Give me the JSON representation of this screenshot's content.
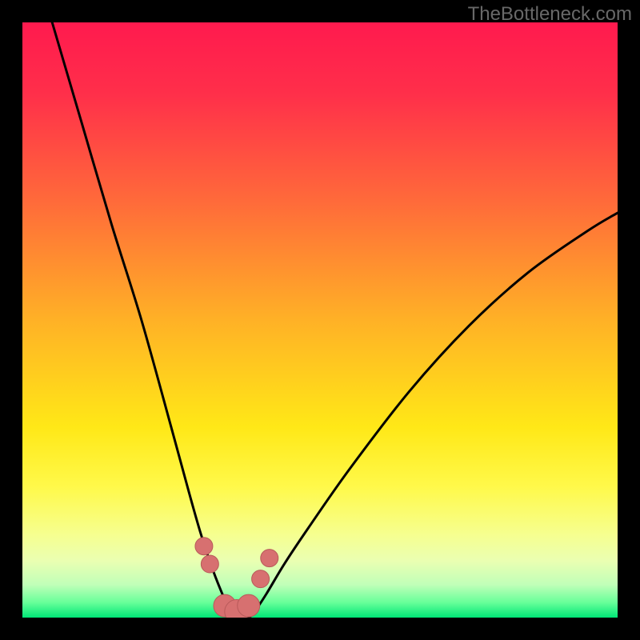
{
  "watermark": "TheBottleneck.com",
  "colors": {
    "frame": "#000000",
    "watermark": "#686868",
    "gradient_stops": [
      {
        "offset": 0.0,
        "color": "#ff1a4e"
      },
      {
        "offset": 0.12,
        "color": "#ff2f4a"
      },
      {
        "offset": 0.3,
        "color": "#ff6a3a"
      },
      {
        "offset": 0.5,
        "color": "#ffb126"
      },
      {
        "offset": 0.68,
        "color": "#ffe817"
      },
      {
        "offset": 0.78,
        "color": "#fff94a"
      },
      {
        "offset": 0.86,
        "color": "#f6ff8f"
      },
      {
        "offset": 0.905,
        "color": "#eaffb2"
      },
      {
        "offset": 0.945,
        "color": "#c0ffb8"
      },
      {
        "offset": 0.975,
        "color": "#66ff99"
      },
      {
        "offset": 1.0,
        "color": "#00e676"
      }
    ],
    "curve": "#000000",
    "marker_fill": "#d77070",
    "marker_stroke": "#b85a5a"
  },
  "chart_data": {
    "type": "line",
    "title": "",
    "xlabel": "",
    "ylabel": "",
    "xlim": [
      0,
      100
    ],
    "ylim": [
      0,
      100
    ],
    "series": [
      {
        "name": "bottleneck-curve",
        "x": [
          5,
          10,
          15,
          20,
          25,
          28,
          30,
          32,
          34,
          35,
          36,
          37,
          38,
          39,
          41,
          44,
          48,
          55,
          65,
          75,
          85,
          95,
          100
        ],
        "y": [
          100,
          83,
          66,
          50,
          32,
          21,
          14,
          8,
          3,
          1,
          0,
          0,
          0,
          1,
          4,
          9,
          15,
          25,
          38,
          49,
          58,
          65,
          68
        ]
      }
    ],
    "markers": {
      "name": "highlight-points",
      "x": [
        30.5,
        31.5,
        34.0,
        36.0,
        38.0,
        40.0,
        41.5
      ],
      "y": [
        12.0,
        9.0,
        2.0,
        1.0,
        2.0,
        6.5,
        10.0
      ],
      "r": [
        11,
        11,
        14,
        15,
        14,
        11,
        11
      ]
    }
  }
}
